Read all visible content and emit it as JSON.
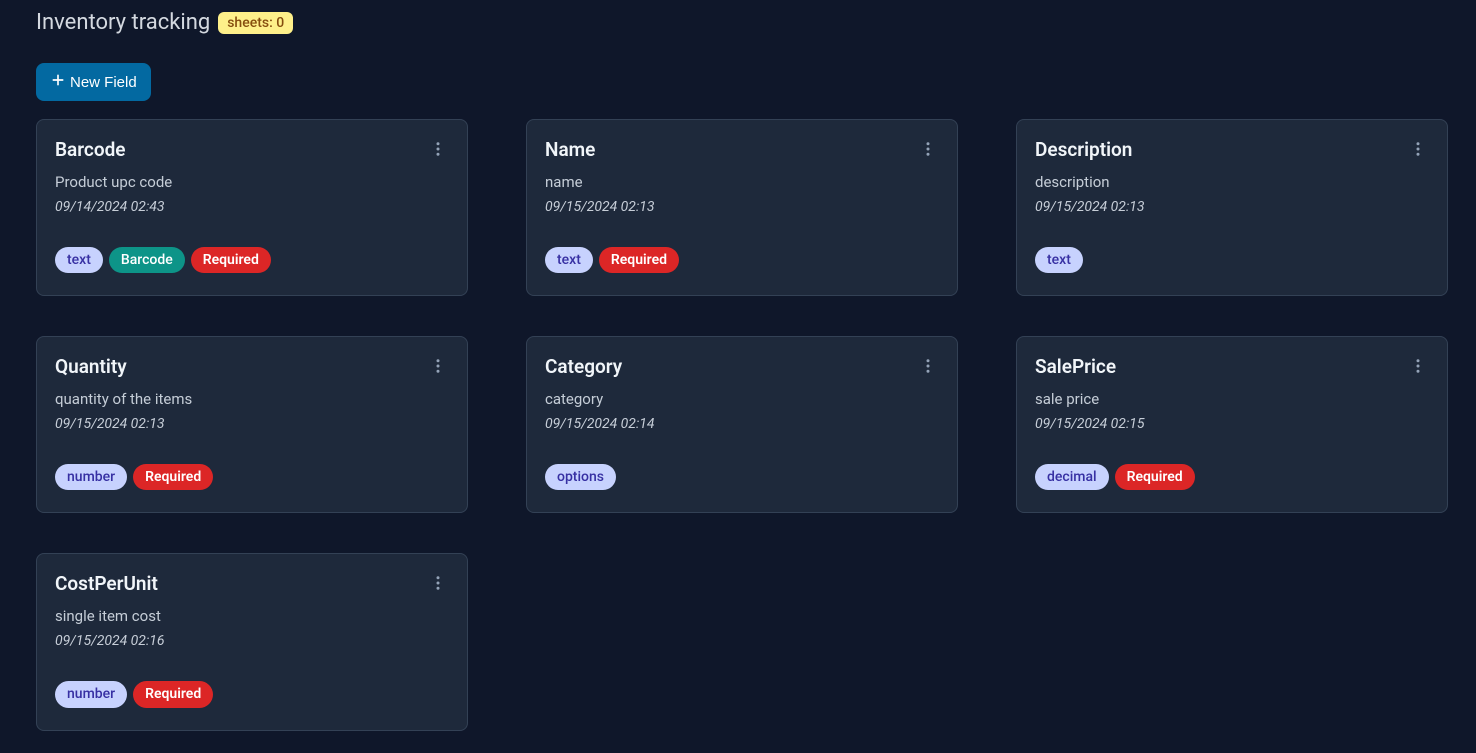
{
  "header": {
    "title": "Inventory tracking",
    "sheets_label": "sheets: 0"
  },
  "actions": {
    "new_field_label": "New Field"
  },
  "cards": [
    {
      "title": "Barcode",
      "description": "Product upc code",
      "date": "09/14/2024 02:43",
      "tags": [
        {
          "label": "text",
          "style": "type"
        },
        {
          "label": "Barcode",
          "style": "teal"
        },
        {
          "label": "Required",
          "style": "required"
        }
      ]
    },
    {
      "title": "Name",
      "description": "name",
      "date": "09/15/2024 02:13",
      "tags": [
        {
          "label": "text",
          "style": "type"
        },
        {
          "label": "Required",
          "style": "required"
        }
      ]
    },
    {
      "title": "Description",
      "description": "description",
      "date": "09/15/2024 02:13",
      "tags": [
        {
          "label": "text",
          "style": "type"
        }
      ]
    },
    {
      "title": "Quantity",
      "description": "quantity of the items",
      "date": "09/15/2024 02:13",
      "tags": [
        {
          "label": "number",
          "style": "type"
        },
        {
          "label": "Required",
          "style": "required"
        }
      ]
    },
    {
      "title": "Category",
      "description": "category",
      "date": "09/15/2024 02:14",
      "tags": [
        {
          "label": "options",
          "style": "type"
        }
      ]
    },
    {
      "title": "SalePrice",
      "description": "sale price",
      "date": "09/15/2024 02:15",
      "tags": [
        {
          "label": "decimal",
          "style": "type"
        },
        {
          "label": "Required",
          "style": "required"
        }
      ]
    },
    {
      "title": "CostPerUnit",
      "description": "single item cost",
      "date": "09/15/2024 02:16",
      "tags": [
        {
          "label": "number",
          "style": "type"
        },
        {
          "label": "Required",
          "style": "required"
        }
      ]
    }
  ]
}
